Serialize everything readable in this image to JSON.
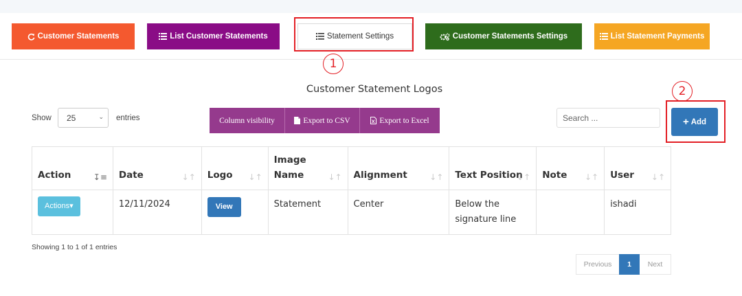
{
  "nav_tabs": [
    {
      "label": "Customer Statements",
      "icon": "refresh-icon",
      "color": "#f4592f"
    },
    {
      "label": "List Customer Statements",
      "icon": "list-icon",
      "color": "#8a0c86"
    },
    {
      "label": "Statement Settings",
      "icon": "list-icon",
      "color": "#ffffff"
    },
    {
      "label": "Customer Statements Settings",
      "icon": "gears-icon",
      "color": "#2e6c1c"
    },
    {
      "label": "List Statement Payments",
      "icon": "list-icon",
      "color": "#f5a623"
    }
  ],
  "annotations": {
    "marker1": "1",
    "marker2": "2",
    "highlight_color": "#e31e24"
  },
  "page_title": "Customer Statement Logos",
  "length_control": {
    "show_label": "Show",
    "value": "25",
    "entries_label": "entries"
  },
  "export_buttons": {
    "column_visibility": "Column visibility",
    "csv": "Export to CSV",
    "excel": "Export to Excel",
    "color": "#953a8d"
  },
  "search": {
    "placeholder": "Search ..."
  },
  "add_button": {
    "label": "Add",
    "color": "#3277b8"
  },
  "table": {
    "columns": [
      "Action",
      "Date",
      "Logo",
      "Image Name",
      "Alignment",
      "Text Position",
      "Note",
      "User"
    ],
    "rows": [
      {
        "action": "Actions",
        "date": "12/11/2024",
        "logo": "View",
        "image_name": "Statement",
        "alignment": "Center",
        "text_position": "Below the signature line",
        "note": "",
        "user": "ishadi"
      }
    ]
  },
  "footer": {
    "info": "Showing 1 to 1 of 1 entries",
    "previous": "Previous",
    "current_page": "1",
    "next": "Next"
  }
}
